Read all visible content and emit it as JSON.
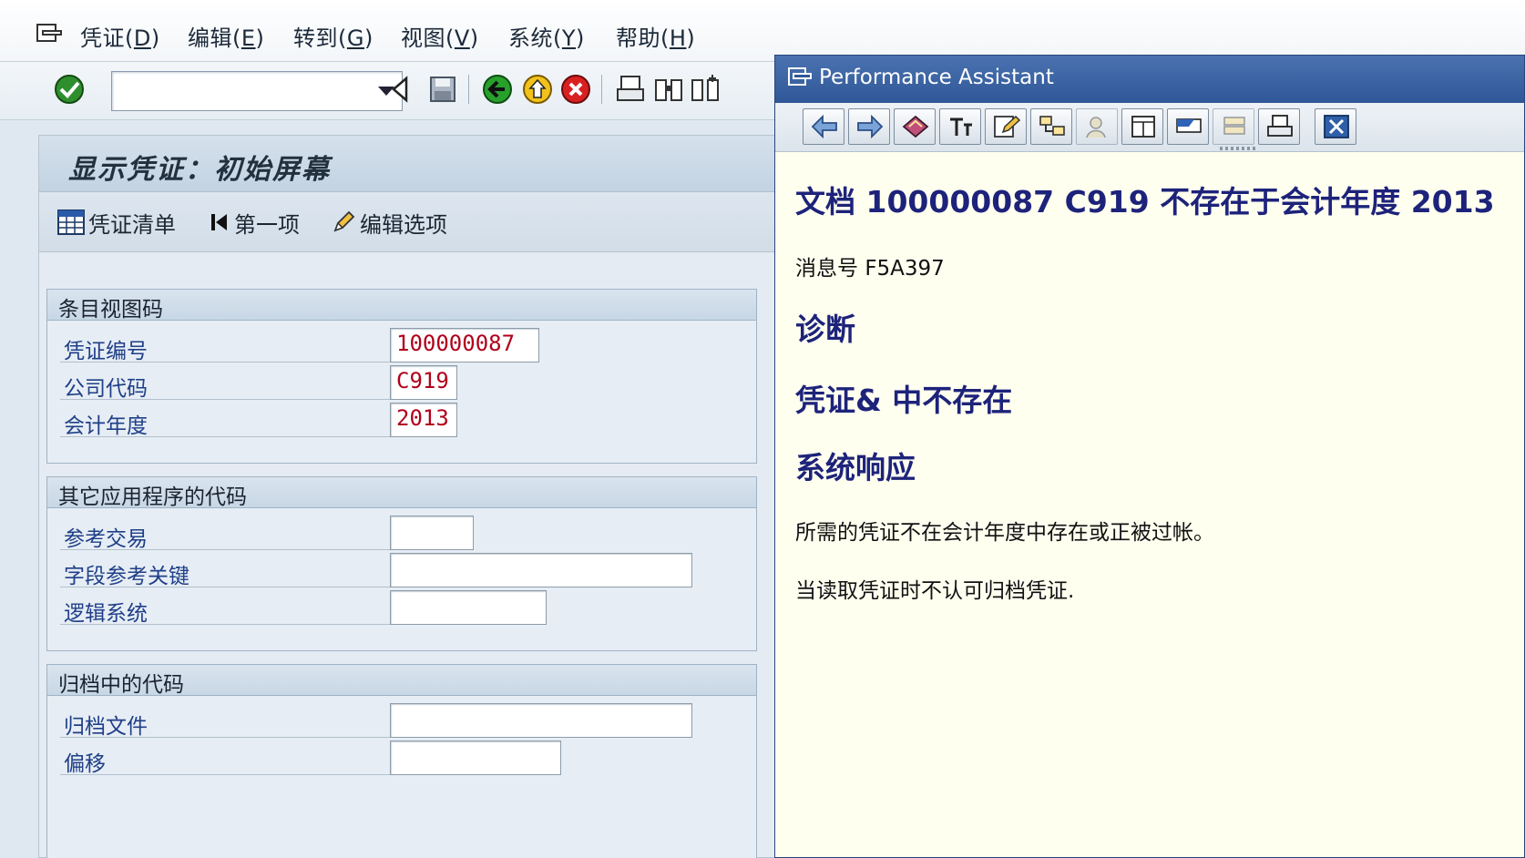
{
  "menubar": {
    "items": [
      {
        "label": "凭证(",
        "hotkey": "D",
        "close": ")"
      },
      {
        "label": "编辑(",
        "hotkey": "E",
        "close": ")"
      },
      {
        "label": "转到(",
        "hotkey": "G",
        "close": ")"
      },
      {
        "label": "视图(",
        "hotkey": "V",
        "close": ")"
      },
      {
        "label": "系统(",
        "hotkey": "Y",
        "close": ")"
      },
      {
        "label": "帮助(",
        "hotkey": "H",
        "close": ")"
      }
    ]
  },
  "toolbar": {
    "command_value": ""
  },
  "main": {
    "title": "显示凭证：初始屏幕",
    "app_buttons": {
      "doc_list": "凭证清单",
      "first_item": "第一项",
      "edit_options": "编辑选项"
    },
    "groups": [
      {
        "title": "条目视图码",
        "rows": [
          {
            "label": "凭证编号",
            "value": "100000087"
          },
          {
            "label": "公司代码",
            "value": "C919"
          },
          {
            "label": "会计年度",
            "value": "2013"
          }
        ]
      },
      {
        "title": "其它应用程序的代码",
        "rows": [
          {
            "label": "参考交易",
            "value": ""
          },
          {
            "label": "字段参考关键",
            "value": ""
          },
          {
            "label": "逻辑系统",
            "value": ""
          }
        ]
      },
      {
        "title": "归档中的代码",
        "rows": [
          {
            "label": "归档文件",
            "value": ""
          },
          {
            "label": "偏移",
            "value": ""
          }
        ]
      }
    ]
  },
  "assistant": {
    "title": "Performance Assistant",
    "heading": "文档  100000087 C919 不存在于会计年度  2013",
    "message_label": "消息号",
    "message_no": "F5A397",
    "diagnosis_title": "诊断",
    "diagnosis_text": "凭证& 中不存在",
    "response_title": "系统响应",
    "response_text1": "所需的凭证不在会计年度中存在或正被过帐。",
    "response_text2": "当读取凭证时不认可归档凭证."
  }
}
